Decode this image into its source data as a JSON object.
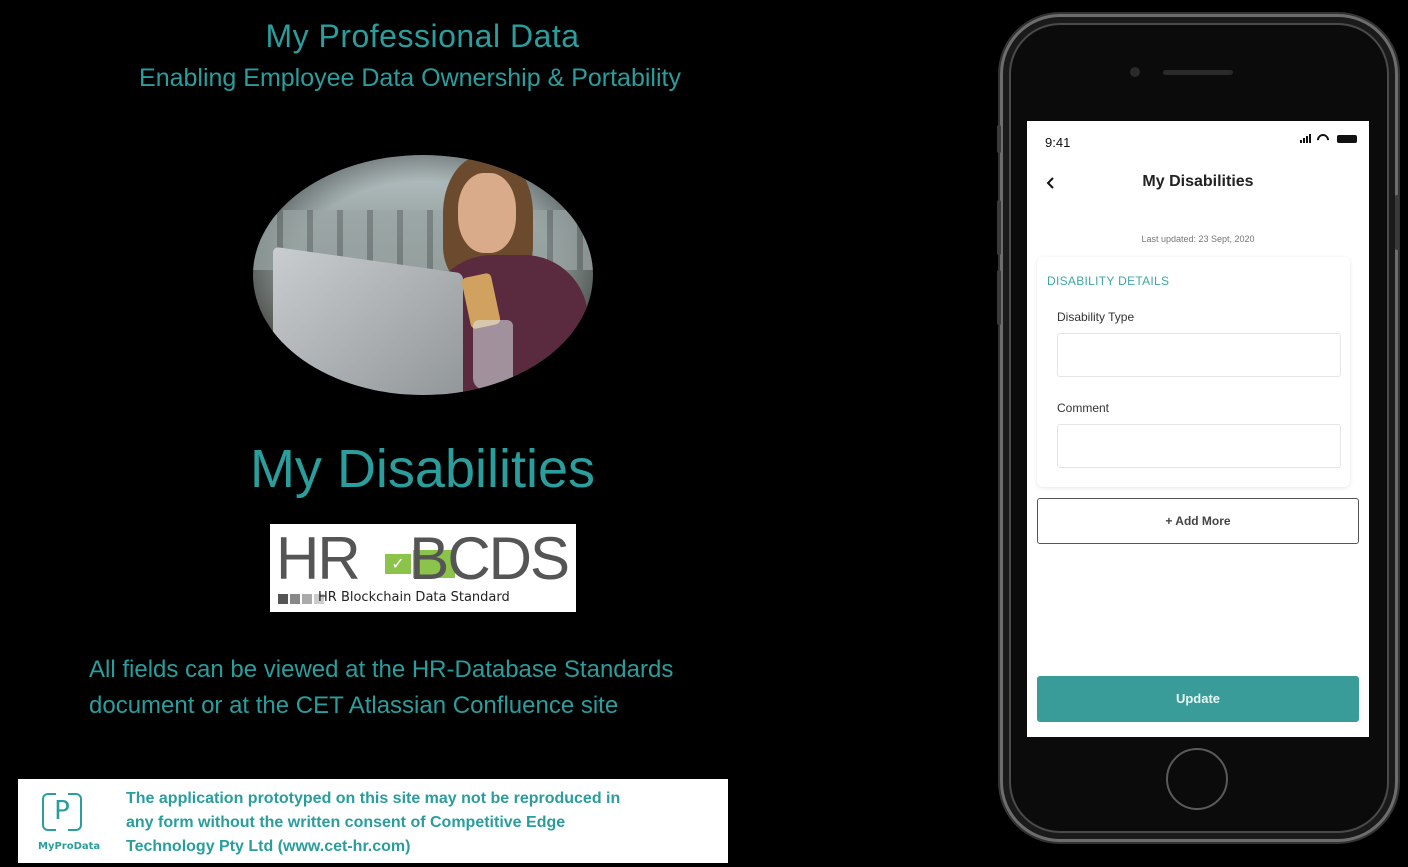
{
  "slide": {
    "title": "My Professional Data",
    "subtitle": "Enabling Employee Data Ownership & Portability",
    "section_heading": "My Disabilities",
    "info_line1": "All fields can be viewed at the HR-Database Standards",
    "info_line2": "document or at the CET Atlassian Confluence site"
  },
  "hr_logo": {
    "left_text": "HR",
    "right_text": "BCDS",
    "tagline": "HR Blockchain Data Standard",
    "square_colors": [
      "#555555",
      "#888888",
      "#aaaaaa",
      "#cccccc"
    ]
  },
  "footer": {
    "logo_letter": "P",
    "logo_caption": "MyProData",
    "notice_line1": "The application prototyped on this site may not be reproduced in",
    "notice_line2": "any form without the written consent of Competitive Edge",
    "notice_line3": "Technology Pty Ltd (www.cet-hr.com)"
  },
  "phone": {
    "status_time": "9:41",
    "nav_title": "My Disabilities",
    "last_updated": "Last updated: 23 Sept, 2020",
    "section_heading": "DISABILITY DETAILS",
    "fields": [
      {
        "label": "Disability Type",
        "value": ""
      },
      {
        "label": "Comment",
        "value": ""
      }
    ],
    "add_more_label": "+ Add More",
    "update_label": "Update"
  },
  "colors": {
    "accent": "#2a9d9d",
    "button": "#3a9c99",
    "background": "#000000"
  }
}
